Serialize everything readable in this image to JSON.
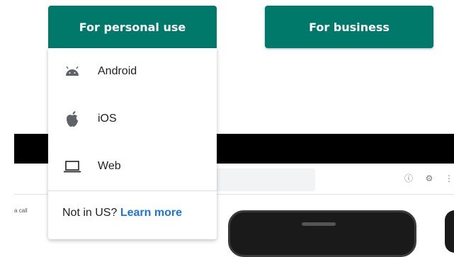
{
  "buttons": {
    "personal_label": "For personal use",
    "business_label": "For business"
  },
  "dropdown": {
    "items": [
      {
        "label": "Android",
        "icon": "android-icon"
      },
      {
        "label": "iOS",
        "icon": "apple-icon"
      },
      {
        "label": "Web",
        "icon": "laptop-icon"
      }
    ],
    "footer_text": "Not in US?",
    "footer_link": "Learn more"
  },
  "background": {
    "partial_text": "a call"
  },
  "colors": {
    "brand": "#00796b",
    "link": "#1a73e8"
  }
}
